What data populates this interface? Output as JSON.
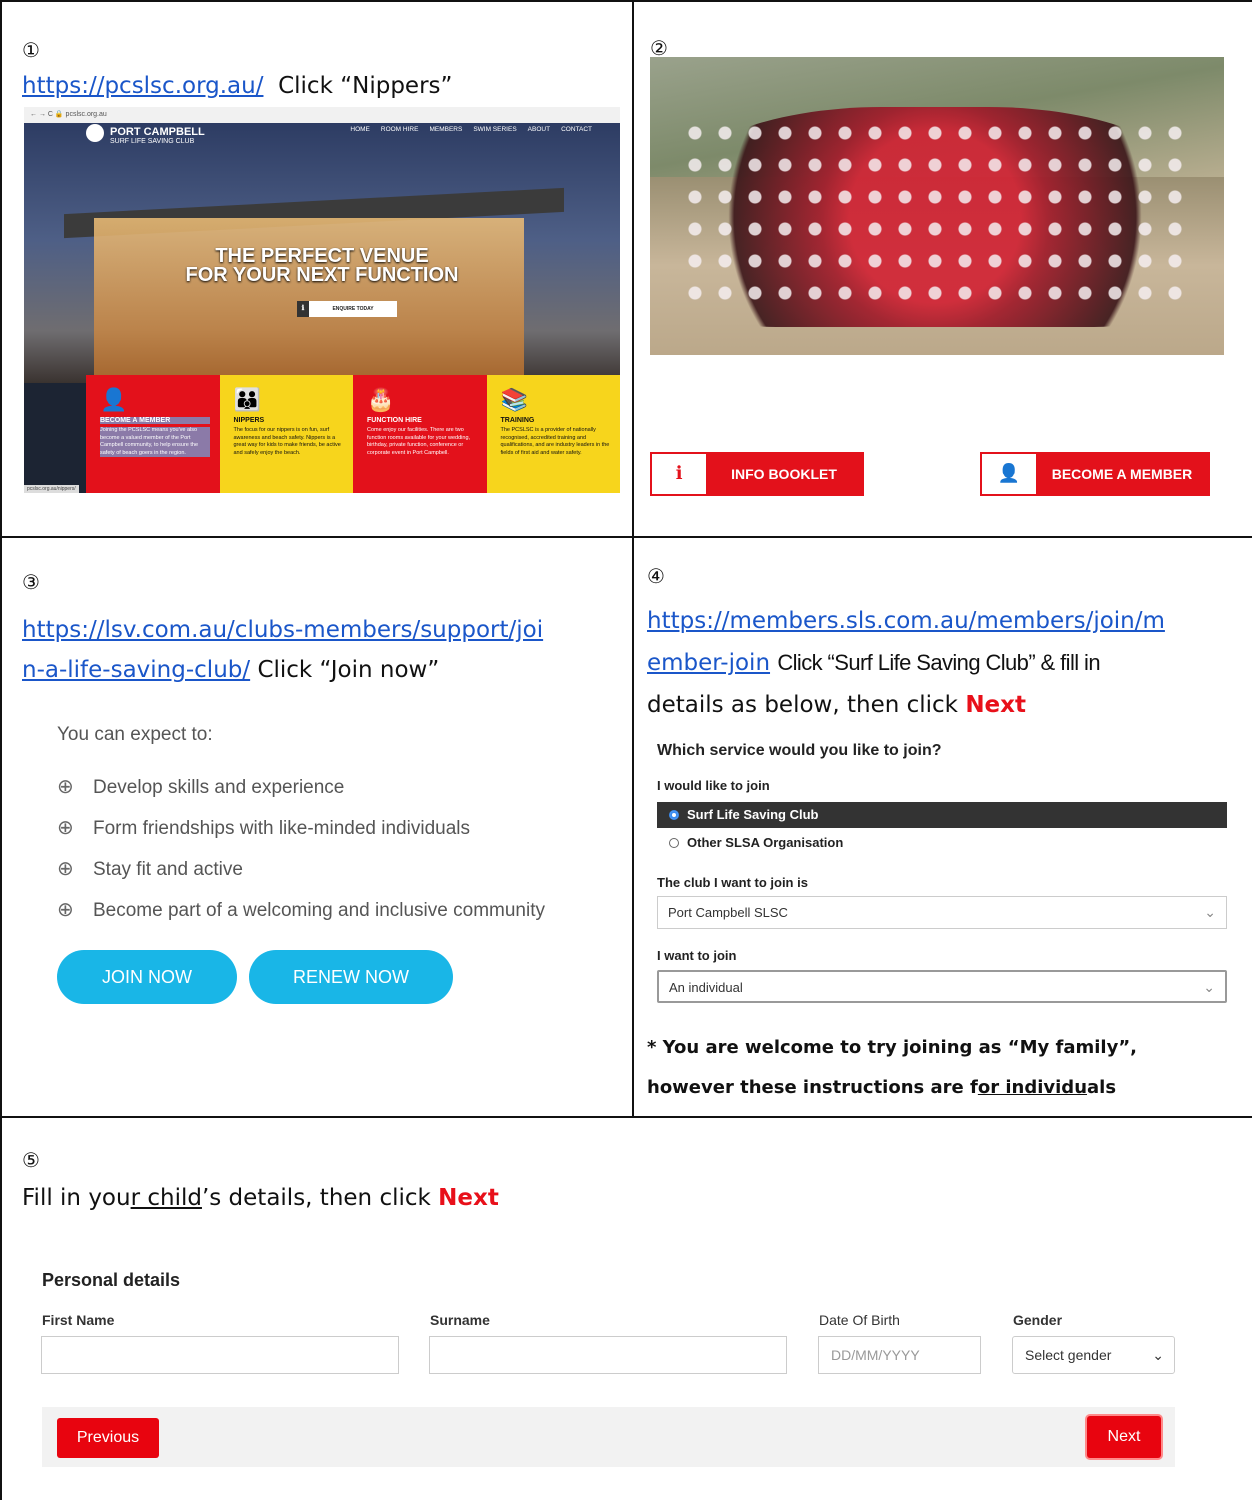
{
  "panel1": {
    "num": "①",
    "url": "https://pcslsc.org.au/",
    "action": "Click “Nippers”",
    "screenshot": {
      "address": "← → C  🔒 pcslsc.org.au",
      "logo_title": "PORT CAMPBELL",
      "logo_sub": "SURF LIFE SAVING CLUB",
      "nav": [
        "HOME",
        "ROOM HIRE",
        "MEMBERS",
        "SWIM SERIES",
        "ABOUT",
        "CONTACT"
      ],
      "hero_line1": "THE PERFECT VENUE",
      "hero_line2": "FOR YOUR NEXT FUNCTION",
      "enquire": "ENQUIRE TODAY",
      "status_url": "pcslsc.org.au/nippers/",
      "tiles": [
        {
          "title": "BECOME A MEMBER",
          "text": "Joining the PCSLSC means you've also become a valued member of the Port Campbell community, to help ensure the safety of beach goers in the region.",
          "icon": "add-user-icon"
        },
        {
          "title": "NIPPERS",
          "text": "The focus for our nippers is on fun, surf awareness and beach safety. Nippers is a great way for kids to make friends, be active and safely enjoy the beach.",
          "icon": "group-icon"
        },
        {
          "title": "FUNCTION HIRE",
          "text": "Come enjoy our facilities. There are two function rooms available for your wedding, birthday, private function, conference or corporate event in Port Campbell.",
          "icon": "cake-icon"
        },
        {
          "title": "TRAINING",
          "text": "The PCSLSC is a provider of nationally recognised, accredited training and qualifications, and are industry leaders in the fields of first aid and water safety.",
          "icon": "books-icon"
        }
      ]
    }
  },
  "panel2": {
    "num": "②",
    "info_button": "INFO BOOKLET",
    "member_button": "BECOME A MEMBER"
  },
  "panel3": {
    "num": "③",
    "url_line1": "https://lsv.com.au/clubs-members/support/joi",
    "url_line2": "n-a-life-saving-club/",
    "action": "Click “Join now”",
    "expect": "You can expect to:",
    "bullets": [
      "Develop skills and experience",
      "Form friendships with like-minded individuals",
      "Stay fit and active",
      "Become part of a welcoming and inclusive community"
    ],
    "join": "JOIN NOW",
    "renew": "RENEW NOW"
  },
  "panel4": {
    "num": "④",
    "url_line1": "https://members.sls.com.au/members/join/m",
    "url_line2": "ember-join",
    "action_a": "Click “Surf Life Saving Club” & fill in",
    "action_b": "details as below, then click",
    "next_word": "Next",
    "question": "Which service would you like to join?",
    "join_label": "I would like to join",
    "option_selected": "Surf Life Saving Club",
    "option_other": "Other SLSA Organisation",
    "club_label": "The club I want to join is",
    "club_value": "Port Campbell SLSC",
    "want_label": "I want to join",
    "want_value": "An individual",
    "note_line1": "* You are welcome to try joining as “My family”,",
    "note_line2a": "however these instructions are f",
    "note_line2b": "or individu",
    "note_line2c": "als"
  },
  "panel5": {
    "num": "⑤",
    "text_a": "Fill in you",
    "text_b": "r child",
    "text_c": "’s details, then click",
    "next_word": "Next",
    "heading": "Personal details",
    "first_name": "First Name",
    "surname": "Surname",
    "dob": "Date Of Birth",
    "dob_placeholder": "DD/MM/YYYY",
    "gender": "Gender",
    "gender_value": "Select gender",
    "previous": "Previous",
    "next": "Next"
  },
  "colors": {
    "brand_red": "#e3111b",
    "brand_yellow": "#f7d51c",
    "pill_blue": "#19b6e7",
    "link_blue": "#1a56c9"
  }
}
